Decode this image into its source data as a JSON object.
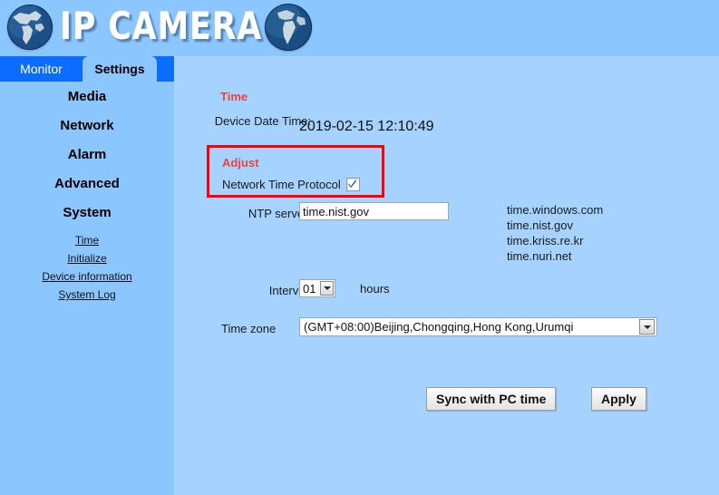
{
  "header": {
    "title": "IP CAMERA",
    "globe_left_icon": "globe-icon",
    "globe_right_icon": "globe-icon"
  },
  "tabs": [
    {
      "id": "monitor",
      "label": "Monitor",
      "active": false
    },
    {
      "id": "settings",
      "label": "Settings",
      "active": true
    }
  ],
  "sidebar": {
    "main_items": [
      {
        "id": "media",
        "label": "Media"
      },
      {
        "id": "network",
        "label": "Network"
      },
      {
        "id": "alarm",
        "label": "Alarm"
      },
      {
        "id": "advanced",
        "label": "Advanced"
      },
      {
        "id": "system",
        "label": "System"
      }
    ],
    "sub_items": [
      {
        "id": "time",
        "label": "Time"
      },
      {
        "id": "initialize",
        "label": "Initialize"
      },
      {
        "id": "device-information",
        "label": "Device information"
      },
      {
        "id": "system-log",
        "label": "System Log"
      }
    ]
  },
  "main": {
    "section_title": "Time",
    "device_date_time_label": "Device Date Time:",
    "device_date_time_value": "2019-02-15 12:10:49",
    "adjust": {
      "title": "Adjust",
      "ntp_label": "Network Time Protocol",
      "ntp_checked": true,
      "highlight_color": "#ff0000"
    },
    "ntp_server_label": "NTP server:",
    "ntp_server_value": "time.nist.gov",
    "ntp_server_placeholder": "",
    "server_suggestions": [
      "time.windows.com",
      "time.nist.gov",
      "time.kriss.re.kr",
      "time.nuri.net"
    ],
    "interval_label": "Interval:",
    "interval_value": "01",
    "interval_unit": "hours",
    "timezone_label": "Time zone",
    "timezone_value": "(GMT+08:00)Beijing,Chongqing,Hong Kong,Urumqi",
    "buttons": {
      "sync": "Sync with PC time",
      "apply": "Apply"
    }
  },
  "colors": {
    "header_bg": "#8cc6ff",
    "content_bg": "#a6d2ff",
    "tab_active_bg": "#0b6cff",
    "section_title": "#e8453c",
    "highlight": "#ff0000"
  }
}
